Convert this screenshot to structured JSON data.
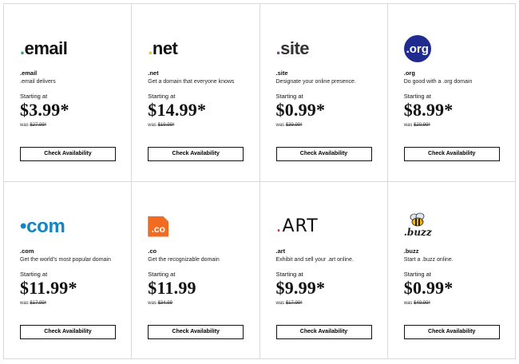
{
  "cards": [
    {
      "logo_text": "email",
      "logo_dot": ".",
      "tld": ".email",
      "desc": ".email delivers",
      "starting": "Starting at",
      "price": "$3.99*",
      "was_prefix": "was",
      "was_price": "$27.99*",
      "button": "Check Availability"
    },
    {
      "logo_text": "net",
      "logo_dot": ".",
      "tld": ".net",
      "desc": "Get a domain that everyone knows",
      "starting": "Starting at",
      "price": "$14.99*",
      "was_prefix": "was",
      "was_price": "$19.99*",
      "button": "Check Availability"
    },
    {
      "logo_text": "site",
      "logo_dot": ".",
      "tld": ".site",
      "desc": "Designate your online presence.",
      "starting": "Starting at",
      "price": "$0.99*",
      "was_prefix": "was",
      "was_price": "$39.99*",
      "button": "Check Availability"
    },
    {
      "logo_text": ".org",
      "tld": ".org",
      "desc": "Do good with a .org domain",
      "starting": "Starting at",
      "price": "$8.99*",
      "was_prefix": "was",
      "was_price": "$20.99*",
      "button": "Check Availability"
    },
    {
      "logo_text": "com",
      "logo_dot": "•",
      "tld": ".com",
      "desc": "Get the world’s most popular domain",
      "starting": "Starting at",
      "price": "$11.99*",
      "was_prefix": "was",
      "was_price": "$17.99*",
      "button": "Check Availability"
    },
    {
      "logo_text": ".co",
      "tld": ".co",
      "desc": "Get the recognizable domain",
      "starting": "Starting at",
      "price": "$11.99",
      "was_prefix": "was",
      "was_price": "$34.99",
      "button": "Check Availability"
    },
    {
      "logo_text": "ART",
      "logo_dot": ".",
      "tld": ".art",
      "desc": "Exhibit and sell your .art online.",
      "starting": "Starting at",
      "price": "$9.99*",
      "was_prefix": "was",
      "was_price": "$17.99*",
      "button": "Check Availability"
    },
    {
      "logo_text": ".buzz",
      "tld": ".buzz",
      "desc": "Start a .buzz online.",
      "starting": "Starting at",
      "price": "$0.99*",
      "was_prefix": "was",
      "was_price": "$49.99*",
      "button": "Check Availability"
    }
  ],
  "colors": {
    "email_dot": "#1aa58a",
    "net_dot": "#f5c40e",
    "site_dot": "#7b3fbf",
    "org_bg": "#1f2b8f",
    "com_blue": "#1485c4",
    "co_orange": "#f26b21",
    "art_dot": "#e0222a"
  }
}
